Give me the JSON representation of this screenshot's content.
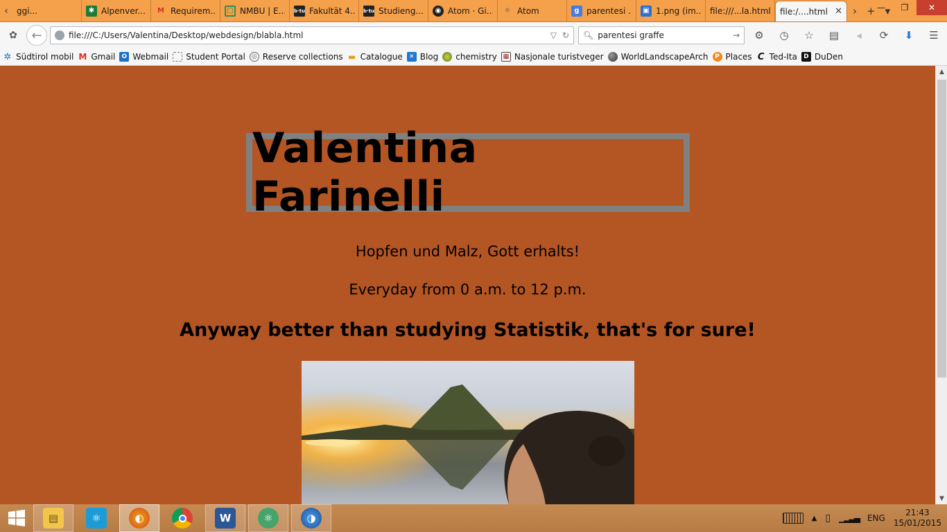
{
  "browser": {
    "tabs": [
      {
        "label": "ggi...",
        "icon": "page-icon",
        "active": false
      },
      {
        "label": "Alpenver...",
        "icon": "alpenverein-icon",
        "active": false
      },
      {
        "label": "Requirem...",
        "icon": "gmail-icon",
        "active": false
      },
      {
        "label": "NMBU | E...",
        "icon": "nmbu-icon",
        "active": false
      },
      {
        "label": "Fakultät 4...",
        "icon": "btu-icon",
        "active": false
      },
      {
        "label": "Studieng...",
        "icon": "btu-icon",
        "active": false
      },
      {
        "label": "Atom · Gi...",
        "icon": "github-icon",
        "active": false
      },
      {
        "label": "Atom",
        "icon": "atom-icon",
        "active": false
      },
      {
        "label": "parentesi ...",
        "icon": "google-icon",
        "active": false
      },
      {
        "label": "1.png (im...",
        "icon": "image-icon",
        "active": false
      },
      {
        "label": "file:///...la.html",
        "icon": "none",
        "active": false
      },
      {
        "label": "file:/....html",
        "icon": "none",
        "active": true
      }
    ],
    "url": "file:///C:/Users/Valentina/Desktop/webdesign/blabla.html",
    "search_value": "parentesi graffe",
    "bookmarks": [
      {
        "label": "Südtirol mobil",
        "icon": "gear-icon"
      },
      {
        "label": "Gmail",
        "icon": "gmail-icon"
      },
      {
        "label": "Webmail",
        "icon": "outlook-icon"
      },
      {
        "label": "Student Portal",
        "icon": "page-icon"
      },
      {
        "label": "Reserve collections",
        "icon": "seal-icon"
      },
      {
        "label": "Catalogue",
        "icon": "pencil-icon"
      },
      {
        "label": "Blog",
        "icon": "x-icon"
      },
      {
        "label": "chemistry",
        "icon": "globe-icon"
      },
      {
        "label": "Nasjonale turistveger",
        "icon": "grid-icon"
      },
      {
        "label": "WorldLandscapeArch",
        "icon": "sphere-icon"
      },
      {
        "label": "Places",
        "icon": "p-icon"
      },
      {
        "label": "Ted-Ita",
        "icon": "c-icon"
      },
      {
        "label": "DuDen",
        "icon": "d-icon"
      }
    ]
  },
  "page": {
    "title": "Valentina Farinelli",
    "line1": "Hopfen und Malz, Gott erhalts!",
    "line2": "Everyday from 0 a.m. to 12 p.m.",
    "headline": "Anyway better than studying Statistik, that's for sure!",
    "photo_alt": "Kirkjufell mountain at sunset with woman in foreground"
  },
  "taskbar": {
    "apps": [
      "file-explorer-icon",
      "atom-icon",
      "firefox-icon",
      "chrome-icon",
      "word-icon",
      "atom-icon",
      "firefox-dev-icon"
    ],
    "language": "ENG",
    "time": "21:43",
    "date": "15/01/2015"
  },
  "colors": {
    "page_background": "#b45524",
    "title_border": "#808080",
    "tab_bar": "#f5a04a"
  }
}
